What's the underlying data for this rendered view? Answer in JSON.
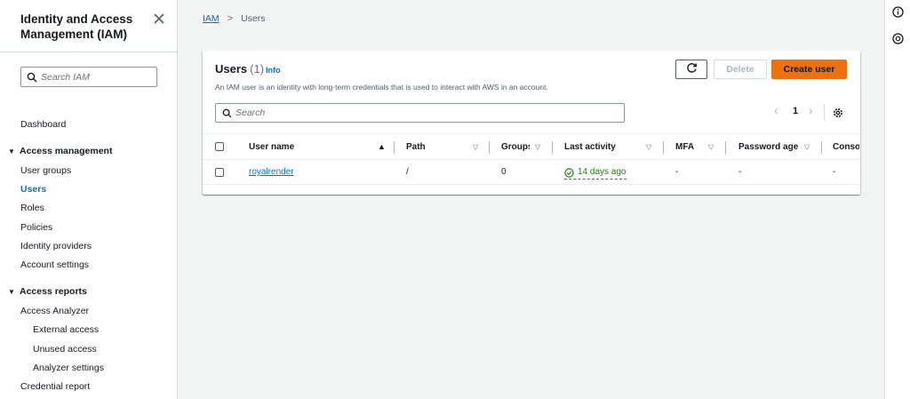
{
  "sidebar": {
    "title": "Identity and Access Management (IAM)",
    "search_placeholder": "Search IAM",
    "dashboard": "Dashboard",
    "sections": [
      {
        "label": "Access management",
        "items": [
          "User groups",
          "Users",
          "Roles",
          "Policies",
          "Identity providers",
          "Account settings"
        ]
      },
      {
        "label": "Access reports",
        "items": [
          "Access Analyzer",
          "External access",
          "Unused access",
          "Analyzer settings",
          "Credential report"
        ]
      }
    ],
    "active_item": "Users"
  },
  "breadcrumb": {
    "root": "IAM",
    "current": "Users"
  },
  "panel": {
    "title": "Users",
    "count": "(1)",
    "info": "Info",
    "description": "An IAM user is an identity with long-term credentials that is used to interact with AWS in an account.",
    "delete_label": "Delete",
    "create_label": "Create user",
    "search_placeholder": "Search",
    "page": "1"
  },
  "table": {
    "columns": [
      "User name",
      "Path",
      "Groups",
      "Last activity",
      "MFA",
      "Password age",
      "Conso"
    ],
    "rows": [
      {
        "user_name": "royalrender",
        "path": "/",
        "groups": "0",
        "last_activity": "14 days ago",
        "mfa": "-",
        "password_age": "-",
        "console": "-"
      }
    ]
  },
  "colors": {
    "accent": "#0073bb",
    "primary_button": "#ec7211",
    "success": "#1d8102"
  },
  "icons": {
    "close": "close-icon",
    "search": "search-icon",
    "refresh": "refresh-icon",
    "settings": "gear-icon",
    "info_rail": "info-circle-icon",
    "help_rail": "help-icon",
    "status_ok": "check-circle-icon"
  }
}
